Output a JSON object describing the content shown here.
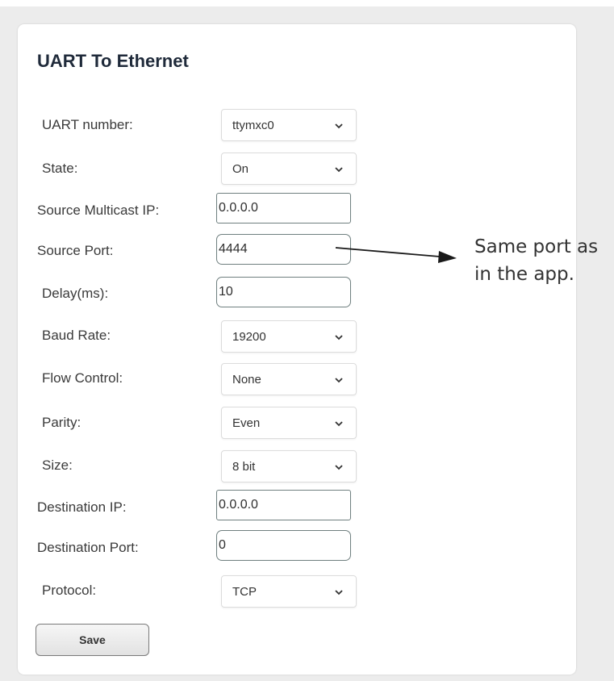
{
  "form": {
    "title": "UART To Ethernet",
    "fields": {
      "uart_number": {
        "label": "UART number:",
        "value": "ttymxc0"
      },
      "state": {
        "label": "State:",
        "value": "On"
      },
      "source_multicast_ip": {
        "label": "Source Multicast IP:",
        "value": "0.0.0.0"
      },
      "source_port": {
        "label": "Source Port:",
        "value": "4444"
      },
      "delay": {
        "label": "Delay(ms):",
        "value": "10"
      },
      "baud_rate": {
        "label": "Baud Rate:",
        "value": "19200"
      },
      "flow_control": {
        "label": "Flow Control:",
        "value": "None"
      },
      "parity": {
        "label": "Parity:",
        "value": "Even"
      },
      "size": {
        "label": "Size:",
        "value": "8 bit"
      },
      "destination_ip": {
        "label": "Destination IP:",
        "value": "0.0.0.0"
      },
      "destination_port": {
        "label": "Destination Port:",
        "value": "0"
      },
      "protocol": {
        "label": "Protocol:",
        "value": "TCP"
      }
    },
    "save_label": "Save"
  },
  "annotation": {
    "line1": "Same port as",
    "line2": "in the app."
  },
  "icons": {
    "dropdown": "chevron-down-icon",
    "pointer": "arrow-right-icon"
  },
  "colors": {
    "page_background": "#ececec",
    "panel_background": "#ffffff",
    "title_text": "#1f2a3a",
    "input_border": "#6f7f7f"
  }
}
